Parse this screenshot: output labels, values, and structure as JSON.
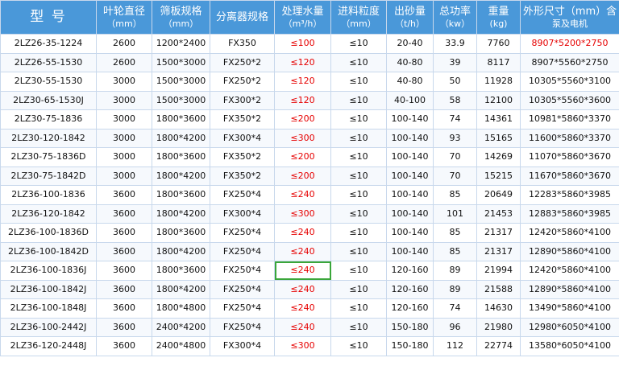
{
  "headers": [
    {
      "line1": "型 号",
      "line2": ""
    },
    {
      "line1": "叶轮直径",
      "line2": "（mm）"
    },
    {
      "line1": "筛板规格",
      "line2": "（mm）"
    },
    {
      "line1": "分离器规格",
      "line2": ""
    },
    {
      "line1": "处理水量",
      "line2": "（m³/h）"
    },
    {
      "line1": "进料粒度",
      "line2": "（mm）"
    },
    {
      "line1": "出砂量",
      "line2": "（t/h）"
    },
    {
      "line1": "总功率",
      "line2": "（kw）"
    },
    {
      "line1": "重量",
      "line2": "(kg)"
    },
    {
      "line1": "外形尺寸（mm）含",
      "line2": "泵及电机"
    }
  ],
  "rows": [
    [
      "2LZ26-35-1224",
      "2600",
      "1200*2400",
      "FX350",
      "≤100",
      "≤10",
      "20-40",
      "33.9",
      "7760",
      "8907*5200*2750"
    ],
    [
      "2LZ26-55-1530",
      "2600",
      "1500*3000",
      "FX250*2",
      "≤120",
      "≤10",
      "40-80",
      "39",
      "8117",
      "8907*5560*2750"
    ],
    [
      "2LZ30-55-1530",
      "3000",
      "1500*3000",
      "FX250*2",
      "≤120",
      "≤10",
      "40-80",
      "50",
      "11928",
      "10305*5560*3100"
    ],
    [
      "2LZ30-65-1530J",
      "3000",
      "1500*3000",
      "FX300*2",
      "≤120",
      "≤10",
      "40-100",
      "58",
      "12100",
      "10305*5560*3600"
    ],
    [
      "2LZ30-75-1836",
      "3000",
      "1800*3600",
      "FX350*2",
      "≤200",
      "≤10",
      "100-140",
      "74",
      "14361",
      "10981*5860*3370"
    ],
    [
      "2LZ30-120-1842",
      "3000",
      "1800*4200",
      "FX300*4",
      "≤300",
      "≤10",
      "100-140",
      "93",
      "15165",
      "11600*5860*3370"
    ],
    [
      "2LZ30-75-1836D",
      "3000",
      "1800*3600",
      "FX350*2",
      "≤200",
      "≤10",
      "100-140",
      "70",
      "14269",
      "11070*5860*3670"
    ],
    [
      "2LZ30-75-1842D",
      "3000",
      "1800*4200",
      "FX350*2",
      "≤200",
      "≤10",
      "100-140",
      "70",
      "15215",
      "11670*5860*3670"
    ],
    [
      "2LZ36-100-1836",
      "3600",
      "1800*3600",
      "FX250*4",
      "≤240",
      "≤10",
      "100-140",
      "85",
      "20649",
      "12283*5860*3985"
    ],
    [
      "2LZ36-120-1842",
      "3600",
      "1800*4200",
      "FX300*4",
      "≤300",
      "≤10",
      "100-140",
      "101",
      "21453",
      "12883*5860*3985"
    ],
    [
      "2LZ36-100-1836D",
      "3600",
      "1800*3600",
      "FX250*4",
      "≤240",
      "≤10",
      "100-140",
      "85",
      "21317",
      "12420*5860*4100"
    ],
    [
      "2LZ36-100-1842D",
      "3600",
      "1800*4200",
      "FX250*4",
      "≤240",
      "≤10",
      "100-140",
      "85",
      "21317",
      "12890*5860*4100"
    ],
    [
      "2LZ36-100-1836J",
      "3600",
      "1800*3600",
      "FX250*4",
      "≤240",
      "≤10",
      "120-160",
      "89",
      "21994",
      "12420*5860*4100"
    ],
    [
      "2LZ36-100-1842J",
      "3600",
      "1800*4200",
      "FX250*4",
      "≤240",
      "≤10",
      "120-160",
      "89",
      "21588",
      "12890*5860*4100"
    ],
    [
      "2LZ36-100-1848J",
      "3600",
      "1800*4800",
      "FX250*4",
      "≤240",
      "≤10",
      "120-160",
      "74",
      "14630",
      "13490*5860*4100"
    ],
    [
      "2LZ36-100-2442J",
      "3600",
      "2400*4200",
      "FX250*4",
      "≤240",
      "≤10",
      "150-180",
      "96",
      "21980",
      "12980*6050*4100"
    ],
    [
      "2LZ36-120-2448J",
      "3600",
      "2400*4800",
      "FX300*4",
      "≤300",
      "≤10",
      "150-180",
      "112",
      "22774",
      "13580*6050*4100"
    ]
  ],
  "colors": {
    "header_bg": "#4a98d9",
    "water_text": "#e60000",
    "highlight_border": "#3aa63a"
  }
}
